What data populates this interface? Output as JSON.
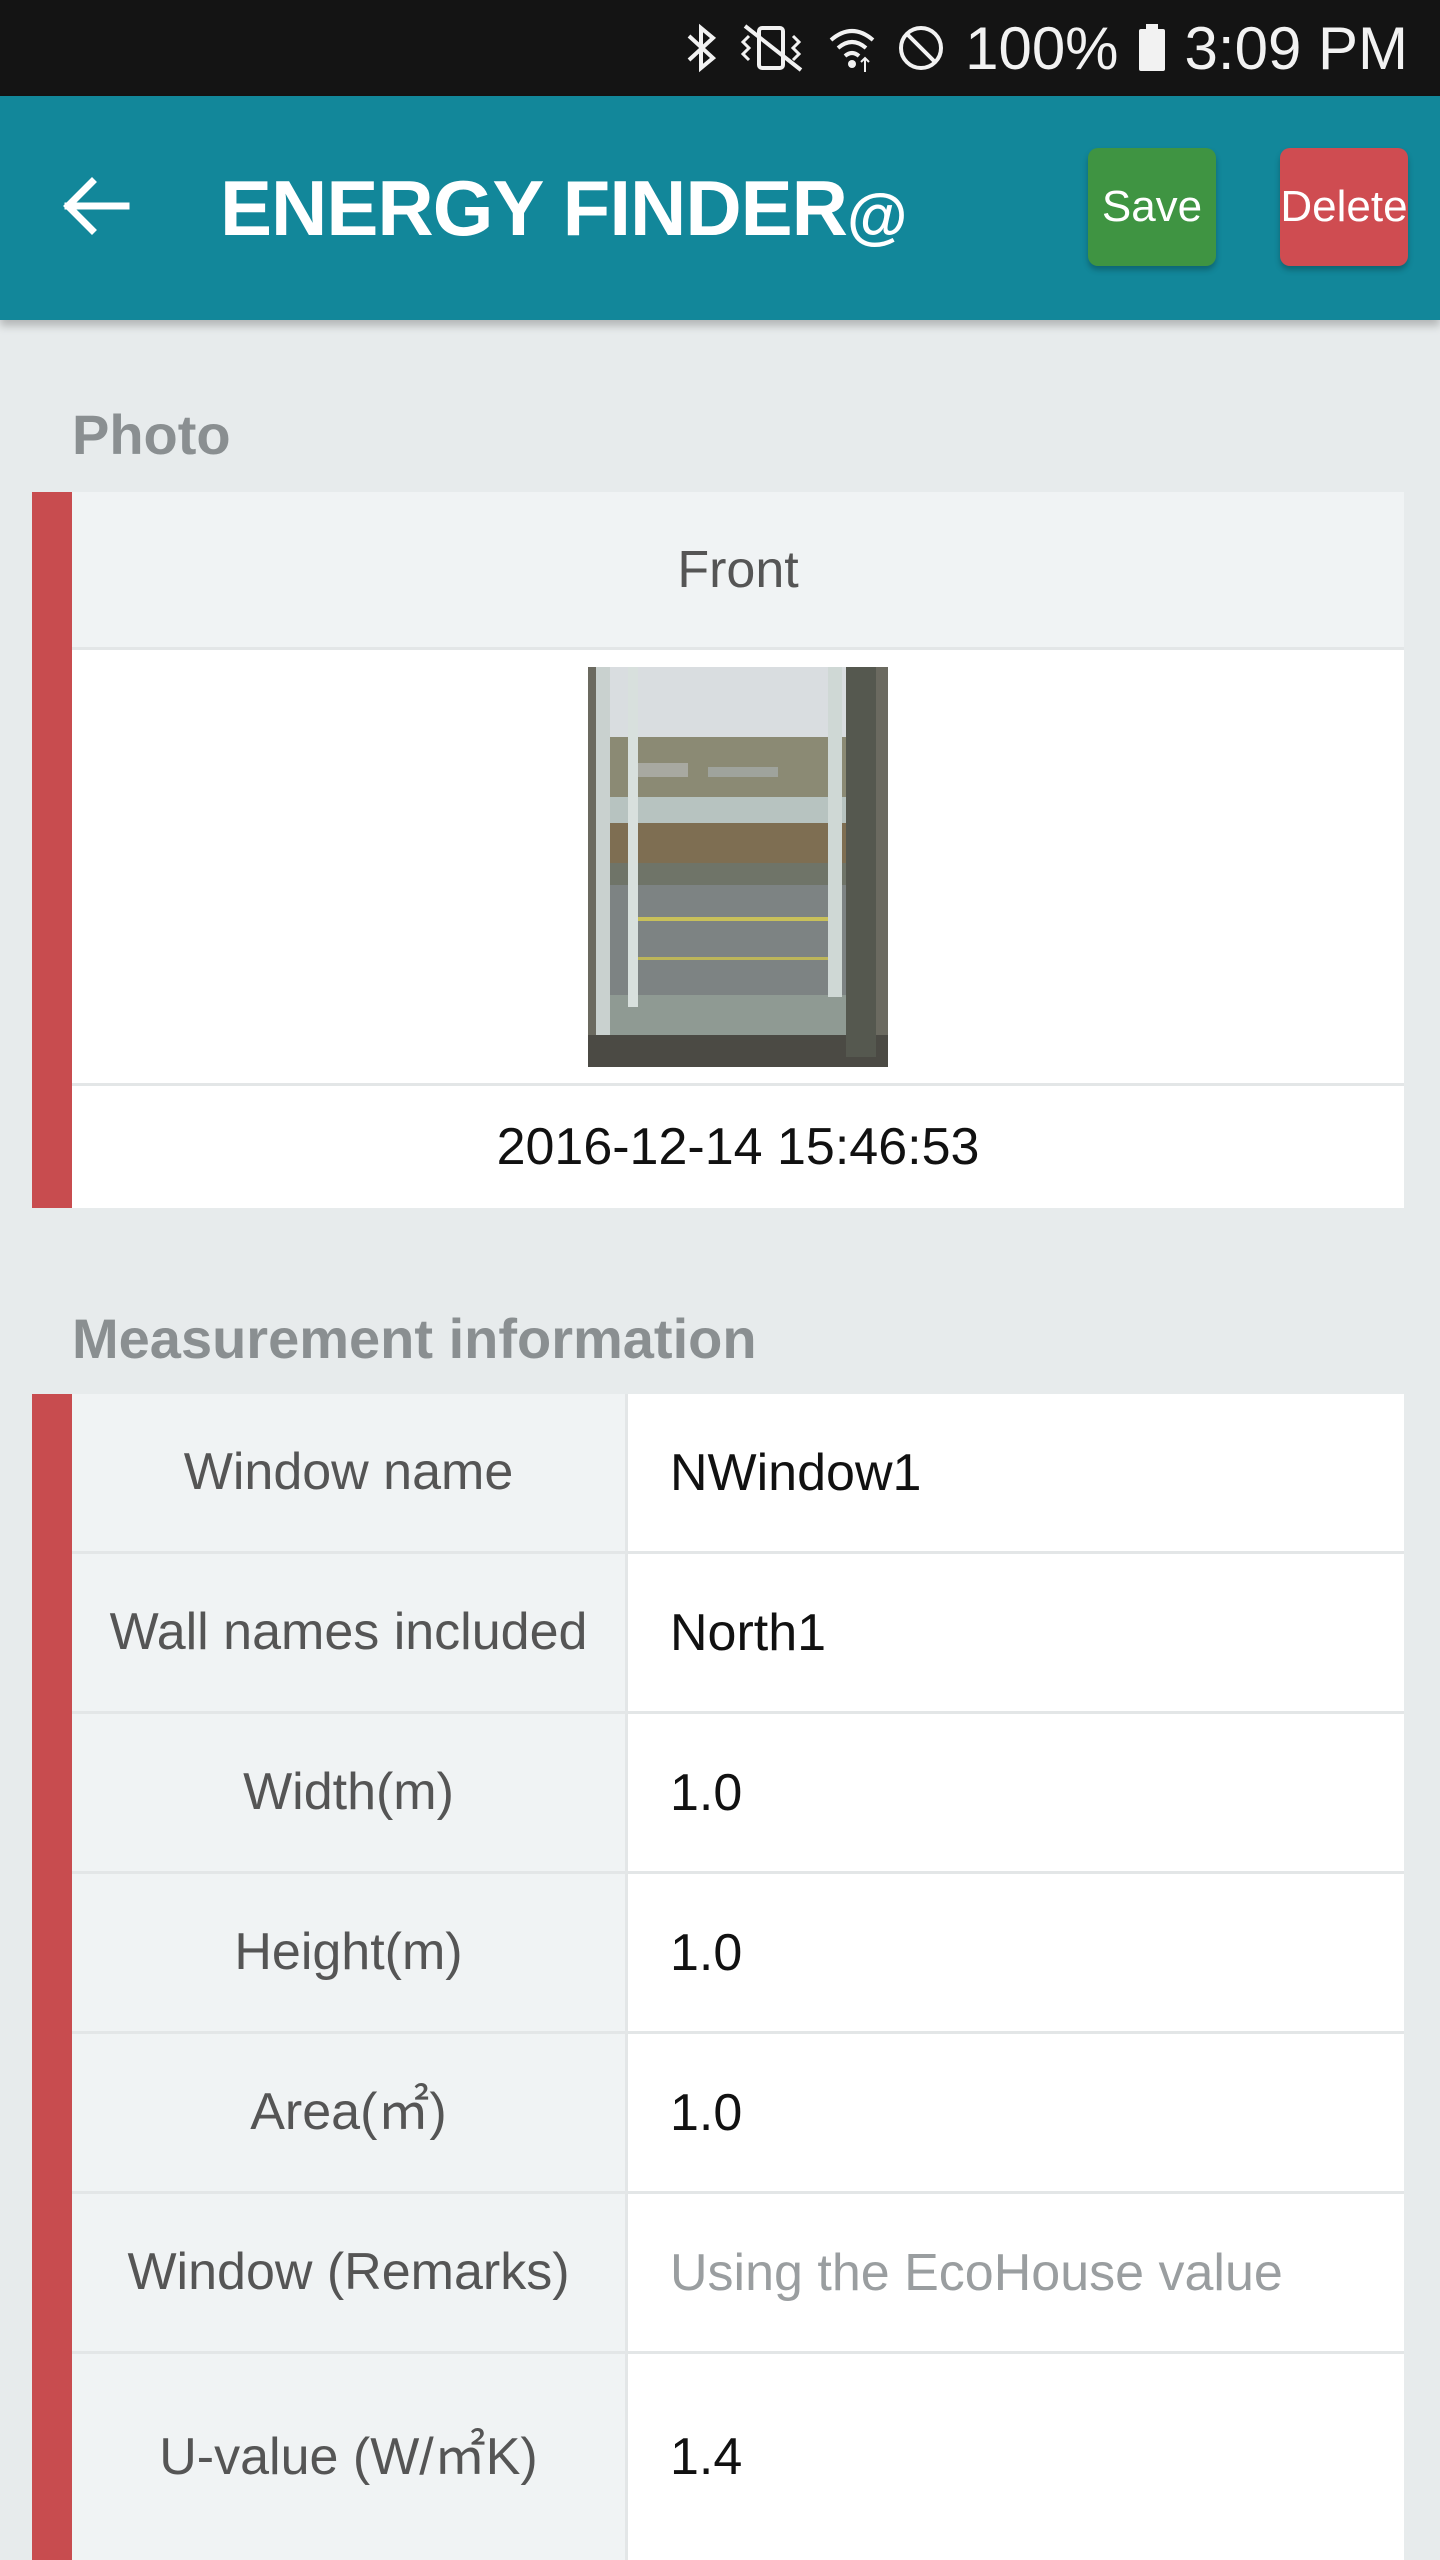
{
  "status_bar": {
    "battery": "100%",
    "time": "3:09 PM"
  },
  "app_bar": {
    "title": "ENERGY FINDER",
    "title_suffix": "@",
    "save_label": "Save",
    "delete_label": "Delete",
    "colors": {
      "bar": "#12879a",
      "save": "#3f9442",
      "delete": "#cf4c51"
    }
  },
  "photo_section": {
    "title": "Photo",
    "header": "Front",
    "date": "2016-12-14 15:46:53"
  },
  "measurement_section": {
    "title": "Measurement information",
    "rows": [
      {
        "label": "Window name",
        "value": "NWindow1"
      },
      {
        "label": "Wall names included",
        "value": "North1"
      },
      {
        "label": "Width(m)",
        "value": "1.0"
      },
      {
        "label": "Height(m)",
        "value": "1.0"
      },
      {
        "label": "Area(㎡)",
        "value": "1.0"
      },
      {
        "label": "Window (Remarks)",
        "placeholder": "Using the EcoHouse value"
      },
      {
        "label": "U-value (W/㎡K)",
        "value": "1.4"
      }
    ]
  },
  "icons": [
    "back-arrow-icon",
    "bluetooth-icon",
    "vibrate-icon",
    "wifi-icon",
    "do-not-disturb-icon",
    "battery-icon"
  ]
}
